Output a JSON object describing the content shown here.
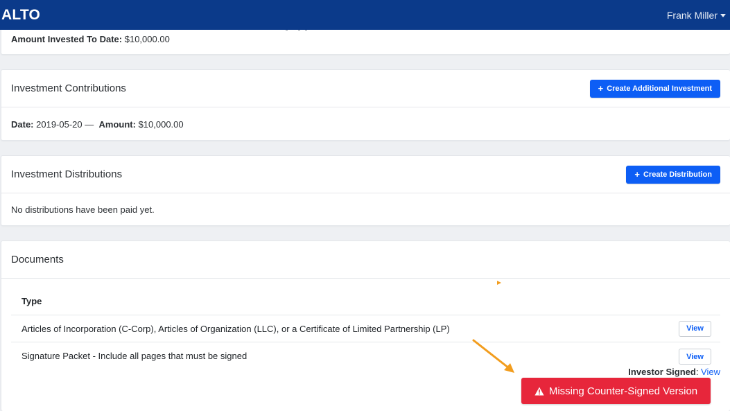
{
  "app": {
    "brand": "ALTO",
    "user_name": "Frank Miller"
  },
  "summary": {
    "amount_label": "Amount Invested To Date:",
    "amount_value": "$10,000.00"
  },
  "contributions": {
    "title": "Investment Contributions",
    "button_label": "Create Additional Investment",
    "date_label": "Date:",
    "date_value": "2019-05-20",
    "separator": "—",
    "amount_label": "Amount:",
    "amount_value": "$10,000.00"
  },
  "distributions": {
    "title": "Investment Distributions",
    "button_label": "Create Distribution",
    "empty_text": "No distributions have been paid yet."
  },
  "documents": {
    "title": "Documents",
    "column_type": "Type",
    "rows": [
      {
        "type": "Articles of Incorporation (C-Corp), Articles of Organization (LLC), or a Certificate of Limited Partnership (LP)",
        "view_label": "View"
      },
      {
        "type": "Signature Packet - Include all pages that must be signed",
        "view_label": "View",
        "investor_signed_label": "Investor Signed",
        "investor_signed_link": "View"
      }
    ],
    "missing_label": "Missing Counter-Signed Version"
  },
  "colors": {
    "navbar": "#0b3a8a",
    "primary": "#0d5ef5",
    "danger": "#e7263b",
    "annotation": "#f29d1e"
  },
  "icons": {
    "plus": "plus-icon",
    "warning": "warning-triangle-icon",
    "caret": "caret-down-icon",
    "annotation": "annotation-arrow"
  }
}
